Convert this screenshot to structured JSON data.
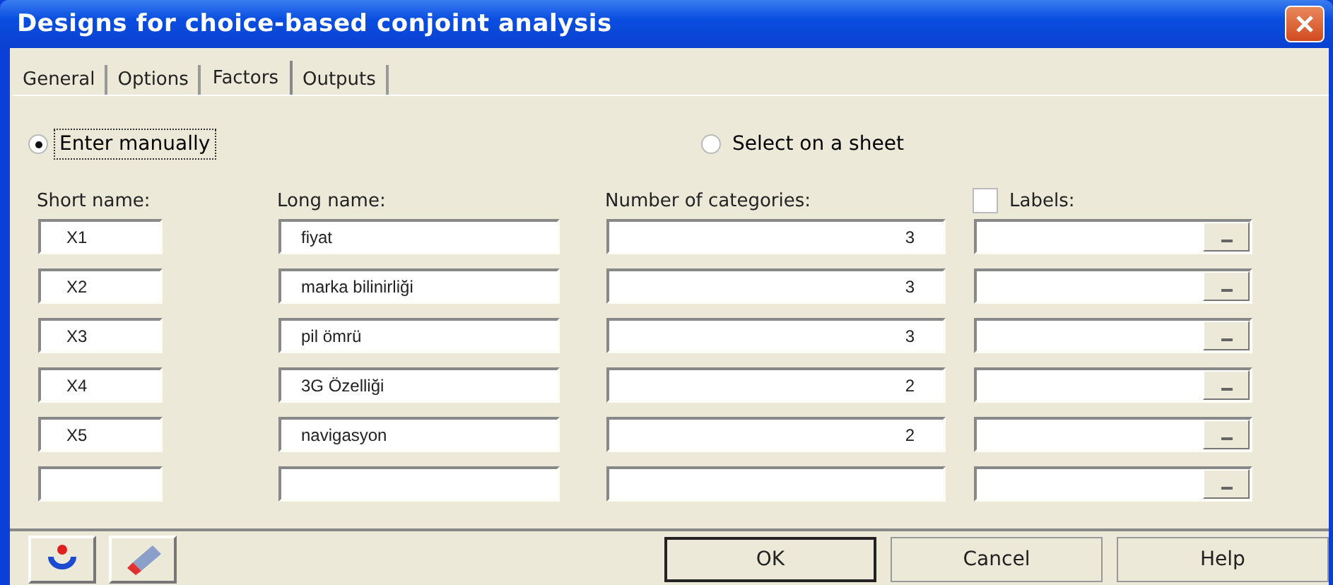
{
  "window": {
    "title": "Designs for choice-based conjoint analysis"
  },
  "tabs": [
    {
      "label": "General",
      "selected": false
    },
    {
      "label": "Options",
      "selected": false
    },
    {
      "label": "Factors",
      "selected": true
    },
    {
      "label": "Outputs",
      "selected": false
    }
  ],
  "source": [
    {
      "label": "Enter manually",
      "selected": true
    },
    {
      "label": "Select on a sheet",
      "selected": false
    }
  ],
  "columns": {
    "short_name": "Short name:",
    "long_name": "Long name:",
    "categories": "Number of categories:",
    "labels": {
      "label": "Labels:",
      "checked": false
    }
  },
  "rows": [
    {
      "short_name": "X1",
      "long_name": "fiyat",
      "categories": "3"
    },
    {
      "short_name": "X2",
      "long_name": "marka bilinirliği",
      "categories": "3"
    },
    {
      "short_name": "X3",
      "long_name": "pil ömrü",
      "categories": "3"
    },
    {
      "short_name": "X4",
      "long_name": "3G Özelliği",
      "categories": "2"
    },
    {
      "short_name": "X5",
      "long_name": "navigasyon",
      "categories": "2"
    },
    {
      "short_name": "",
      "long_name": "",
      "categories": ""
    }
  ],
  "buttons": [
    "OK",
    "Cancel",
    "Help"
  ]
}
